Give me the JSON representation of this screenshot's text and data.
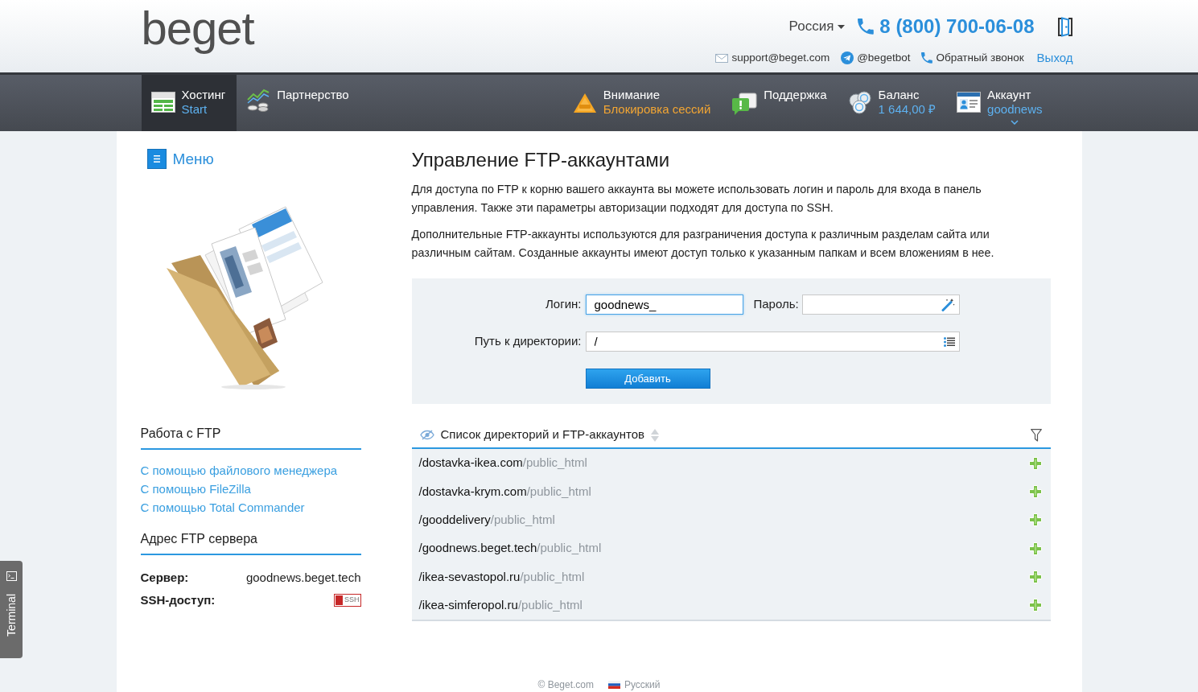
{
  "header": {
    "logo": "beget",
    "region": "Россия",
    "phone": "8 (800) 700-06-08",
    "contacts": [
      {
        "kind": "email",
        "label": "support@beget.com"
      },
      {
        "kind": "telegram",
        "label": "@begetbot"
      },
      {
        "kind": "callback",
        "label": "Обратный звонок"
      }
    ],
    "logout": "Выход"
  },
  "navbar": {
    "left": [
      {
        "kind": "hosting",
        "title": "Хостинг",
        "subtitle": "Start",
        "selected": true,
        "alert": false,
        "dropdown": false
      },
      {
        "kind": "partners",
        "title": "Партнерство",
        "selected": false,
        "alert": false,
        "dropdown": false
      }
    ],
    "right": [
      {
        "kind": "warning",
        "title": "Внимание",
        "subtitle": "Блокировка сессий",
        "selected": false,
        "alert": true,
        "dropdown": false
      },
      {
        "kind": "support",
        "title": "Поддержка",
        "selected": false,
        "alert": false,
        "dropdown": false
      },
      {
        "kind": "balance",
        "title": "Баланс",
        "subtitle": "1 644,00 ₽",
        "selected": false,
        "alert": false,
        "dropdown": false
      },
      {
        "kind": "account",
        "title": "Аккаунт",
        "subtitle": "goodnews",
        "selected": false,
        "alert": false,
        "dropdown": true
      }
    ]
  },
  "sidebar": {
    "menu": "Меню",
    "sections": [
      {
        "title": "Работа с FTP",
        "links": [
          "С помощью файлового менеджера",
          "С помощью FileZilla",
          "С помощью Total Commander"
        ]
      },
      {
        "title": "Адрес FTP сервера",
        "fields": [
          {
            "kind": "text",
            "label": "Сервер:",
            "value": "goodnews.beget.tech"
          },
          {
            "kind": "toggle",
            "label": "SSH-доступ:",
            "value": "SSH",
            "on": false
          }
        ]
      }
    ]
  },
  "terminal": {
    "label": "Terminal"
  },
  "content": {
    "title": "Управление FTP-аккаунтами",
    "paragraphs": [
      "Для доступа по FTP к корню вашего аккаунта вы можете использовать логин и пароль для входа в панель управления. Также эти параметры авторизации подходят для доступа по SSH.",
      "Дополнительные FTP-аккаунты используются для разграничения доступа к различным разделам сайта или различным сайтам. Созданные аккаунты имеют доступ только к указанным папкам и всем вложениям в нее."
    ],
    "form": {
      "login": {
        "label": "Логин:",
        "value": "goodnews_",
        "focused": true
      },
      "password": {
        "label": "Пароль:"
      },
      "path": {
        "label": "Путь к директории:",
        "value": "/"
      },
      "submit": "Добавить"
    },
    "directories": {
      "title": "Список директорий и FTP-аккаунтов",
      "rows": [
        {
          "path": "/dostavka-ikea.com",
          "suffix": "/public_html"
        },
        {
          "path": "/dostavka-krym.com",
          "suffix": "/public_html"
        },
        {
          "path": "/gooddelivery",
          "suffix": "/public_html"
        },
        {
          "path": "/goodnews.beget.tech",
          "suffix": "/public_html"
        },
        {
          "path": "/ikea-sevastopol.ru",
          "suffix": "/public_html"
        },
        {
          "path": "/ikea-simferopol.ru",
          "suffix": "/public_html"
        }
      ]
    }
  },
  "footer": {
    "copyright": "© Beget.com",
    "language": "Русский"
  }
}
